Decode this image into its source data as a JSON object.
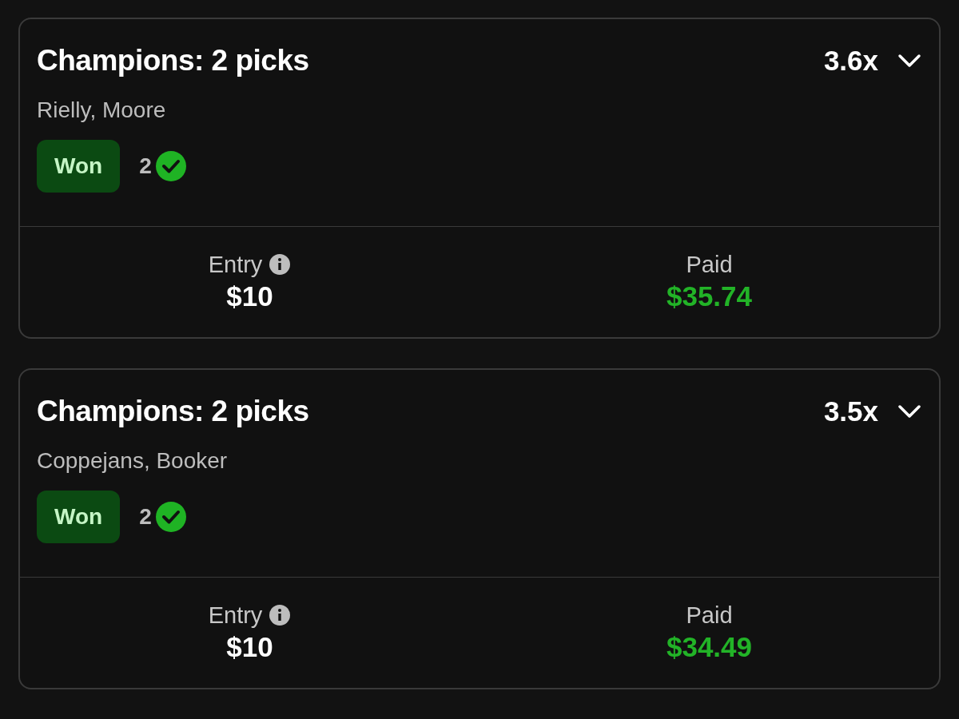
{
  "entries": [
    {
      "title": "Champions: 2 picks",
      "multiplier": "3.6x",
      "expanded": false,
      "players": "Rielly, Moore",
      "status": {
        "label": "Won",
        "kind": "won"
      },
      "correct_count": "2",
      "entry_label": "Entry",
      "entry_amount": "$10",
      "paid_label": "Paid",
      "paid_amount": "$35.74"
    },
    {
      "title": "Champions: 2 picks",
      "multiplier": "3.5x",
      "expanded": false,
      "players": "Coppejans, Booker",
      "status": {
        "label": "Won",
        "kind": "won"
      },
      "correct_count": "2",
      "entry_label": "Entry",
      "entry_amount": "$10",
      "paid_label": "Paid",
      "paid_amount": "$34.49"
    }
  ]
}
